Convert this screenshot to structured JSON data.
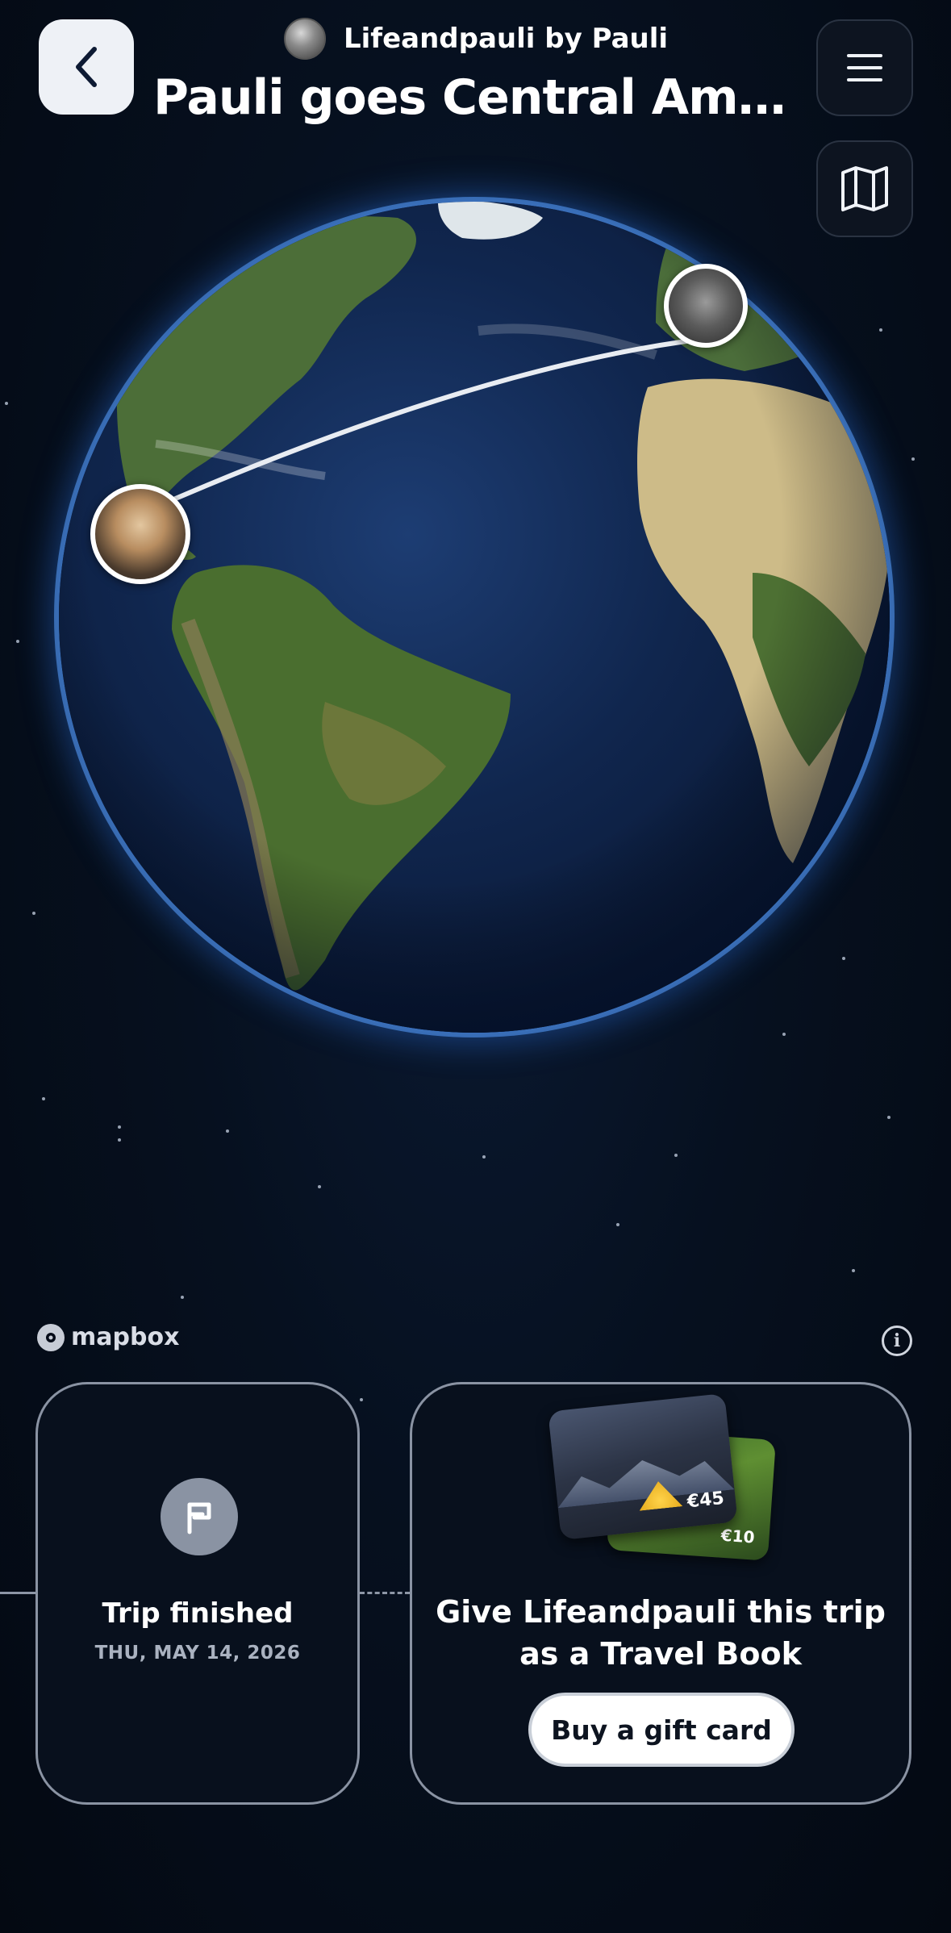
{
  "header": {
    "author": "Lifeandpauli by Pauli",
    "title": "Pauli goes Central America..."
  },
  "icons": {
    "back": "chevron-left-icon",
    "menu": "hamburger-menu-icon",
    "map": "map-icon",
    "info": "info-icon",
    "flag": "flag-icon"
  },
  "map": {
    "attribution": "mapbox"
  },
  "cards": {
    "finished": {
      "title": "Trip finished",
      "date": "THU, MAY 14, 2026"
    },
    "gift": {
      "text": "Give Lifeandpauli this trip as a Travel Book",
      "button_label": "Buy a gift card",
      "price_front": "€45",
      "price_back": "€10"
    }
  },
  "colors": {
    "background": "#050b18",
    "card_border": "#8a93a3",
    "button_bg": "#ffffff",
    "globe_glow": "#3c8cff"
  }
}
